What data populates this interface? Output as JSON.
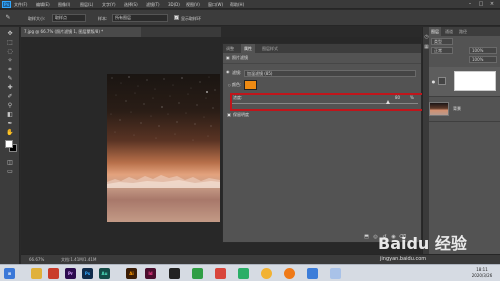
{
  "app": {
    "logo": "Ps",
    "menu": [
      "文件(F)",
      "编辑(E)",
      "图像(I)",
      "图层(L)",
      "文字(Y)",
      "选择(S)",
      "滤镜(T)",
      "3D(D)",
      "视图(V)",
      "窗口(W)",
      "帮助(H)"
    ],
    "window_controls": [
      "–",
      "□",
      "×"
    ]
  },
  "options_bar": {
    "sample_size_label": "取样大小:",
    "sample_size_value": "取样点",
    "sample_label": "样本:",
    "sample_value": "所有图层",
    "show_ring_label": "显示取样环"
  },
  "document": {
    "tab_title": "7.jpg @ 66.7% (照片滤镜 1, 图层蒙版/8) *"
  },
  "status": {
    "zoom": "66.67%",
    "doc_size": "文档:1.41M/1.41M"
  },
  "properties_panel": {
    "tabs": [
      "调整",
      "属性",
      "图层样式"
    ],
    "active_tab": 1,
    "panel_title": "照片滤镜",
    "filter_label": "滤镜:",
    "filter_value": "加温滤镜 (85)",
    "color_label": "颜色:",
    "color_hex": "#EE8A12",
    "density_label": "浓度:",
    "density_value": "80",
    "density_unit": "%",
    "preserve_luminosity_label": "保留明度",
    "preserve_luminosity_checked": true
  },
  "layers_panel": {
    "tabs": [
      "图层",
      "通道",
      "路径"
    ],
    "active_tab": 0,
    "blend_mode": "正常",
    "opacity": "100%",
    "fill": "100%",
    "kind": "类型",
    "layers": [
      {
        "name": "照片滤镜 1",
        "visible": true,
        "type": "adjustment"
      },
      {
        "name": "背景",
        "visible": true,
        "type": "background"
      }
    ]
  },
  "watermark": {
    "brand": "Baidu 经验",
    "url": "jingyan.baidu.com"
  },
  "taskbar": {
    "apps": [
      {
        "name": "start",
        "label": "⊞",
        "color": "#3b78d8"
      },
      {
        "name": "folder",
        "label": "",
        "color": "#e0b13a"
      },
      {
        "name": "pdf",
        "label": "",
        "color": "#c93b2a"
      },
      {
        "name": "premiere",
        "label": "Pr",
        "color": "#2b0b4e"
      },
      {
        "name": "photoshop",
        "label": "Ps",
        "color": "#0f2b4a"
      },
      {
        "name": "audition",
        "label": "Au",
        "color": "#154c48"
      },
      {
        "name": "illustrator",
        "label": "Ai",
        "color": "#3b1d06"
      },
      {
        "name": "indesign",
        "label": "Id",
        "color": "#4a0d2d"
      },
      {
        "name": "media",
        "label": "",
        "color": "#222222"
      },
      {
        "name": "game",
        "label": "",
        "color": "#2f9e44"
      },
      {
        "name": "app-red",
        "label": "",
        "color": "#d8453b"
      },
      {
        "name": "wechat",
        "label": "",
        "color": "#2aae67"
      },
      {
        "name": "chrome",
        "label": "",
        "color": "#f2b233"
      },
      {
        "name": "browser",
        "label": "",
        "color": "#ef7a18"
      },
      {
        "name": "app-blue",
        "label": "",
        "color": "#3c7dd9"
      },
      {
        "name": "app-light",
        "label": "",
        "color": "#a9c2e8"
      }
    ],
    "time": "18:11",
    "date": "2020/3/26"
  }
}
